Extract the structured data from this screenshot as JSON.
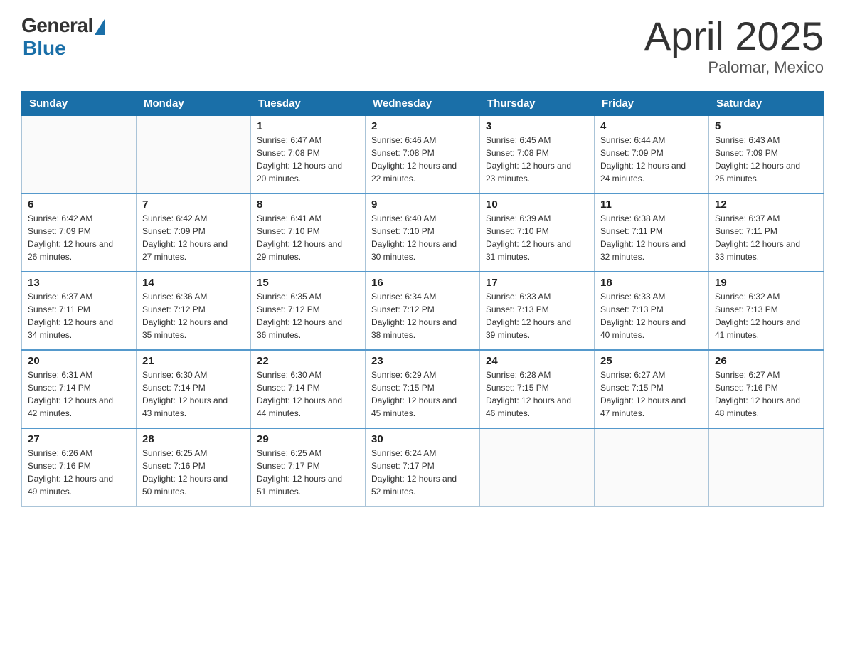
{
  "logo": {
    "general": "General",
    "blue": "Blue"
  },
  "title": "April 2025",
  "subtitle": "Palomar, Mexico",
  "days_header": [
    "Sunday",
    "Monday",
    "Tuesday",
    "Wednesday",
    "Thursday",
    "Friday",
    "Saturday"
  ],
  "weeks": [
    [
      {
        "day": "",
        "sunrise": "",
        "sunset": "",
        "daylight": ""
      },
      {
        "day": "",
        "sunrise": "",
        "sunset": "",
        "daylight": ""
      },
      {
        "day": "1",
        "sunrise": "Sunrise: 6:47 AM",
        "sunset": "Sunset: 7:08 PM",
        "daylight": "Daylight: 12 hours and 20 minutes."
      },
      {
        "day": "2",
        "sunrise": "Sunrise: 6:46 AM",
        "sunset": "Sunset: 7:08 PM",
        "daylight": "Daylight: 12 hours and 22 minutes."
      },
      {
        "day": "3",
        "sunrise": "Sunrise: 6:45 AM",
        "sunset": "Sunset: 7:08 PM",
        "daylight": "Daylight: 12 hours and 23 minutes."
      },
      {
        "day": "4",
        "sunrise": "Sunrise: 6:44 AM",
        "sunset": "Sunset: 7:09 PM",
        "daylight": "Daylight: 12 hours and 24 minutes."
      },
      {
        "day": "5",
        "sunrise": "Sunrise: 6:43 AM",
        "sunset": "Sunset: 7:09 PM",
        "daylight": "Daylight: 12 hours and 25 minutes."
      }
    ],
    [
      {
        "day": "6",
        "sunrise": "Sunrise: 6:42 AM",
        "sunset": "Sunset: 7:09 PM",
        "daylight": "Daylight: 12 hours and 26 minutes."
      },
      {
        "day": "7",
        "sunrise": "Sunrise: 6:42 AM",
        "sunset": "Sunset: 7:09 PM",
        "daylight": "Daylight: 12 hours and 27 minutes."
      },
      {
        "day": "8",
        "sunrise": "Sunrise: 6:41 AM",
        "sunset": "Sunset: 7:10 PM",
        "daylight": "Daylight: 12 hours and 29 minutes."
      },
      {
        "day": "9",
        "sunrise": "Sunrise: 6:40 AM",
        "sunset": "Sunset: 7:10 PM",
        "daylight": "Daylight: 12 hours and 30 minutes."
      },
      {
        "day": "10",
        "sunrise": "Sunrise: 6:39 AM",
        "sunset": "Sunset: 7:10 PM",
        "daylight": "Daylight: 12 hours and 31 minutes."
      },
      {
        "day": "11",
        "sunrise": "Sunrise: 6:38 AM",
        "sunset": "Sunset: 7:11 PM",
        "daylight": "Daylight: 12 hours and 32 minutes."
      },
      {
        "day": "12",
        "sunrise": "Sunrise: 6:37 AM",
        "sunset": "Sunset: 7:11 PM",
        "daylight": "Daylight: 12 hours and 33 minutes."
      }
    ],
    [
      {
        "day": "13",
        "sunrise": "Sunrise: 6:37 AM",
        "sunset": "Sunset: 7:11 PM",
        "daylight": "Daylight: 12 hours and 34 minutes."
      },
      {
        "day": "14",
        "sunrise": "Sunrise: 6:36 AM",
        "sunset": "Sunset: 7:12 PM",
        "daylight": "Daylight: 12 hours and 35 minutes."
      },
      {
        "day": "15",
        "sunrise": "Sunrise: 6:35 AM",
        "sunset": "Sunset: 7:12 PM",
        "daylight": "Daylight: 12 hours and 36 minutes."
      },
      {
        "day": "16",
        "sunrise": "Sunrise: 6:34 AM",
        "sunset": "Sunset: 7:12 PM",
        "daylight": "Daylight: 12 hours and 38 minutes."
      },
      {
        "day": "17",
        "sunrise": "Sunrise: 6:33 AM",
        "sunset": "Sunset: 7:13 PM",
        "daylight": "Daylight: 12 hours and 39 minutes."
      },
      {
        "day": "18",
        "sunrise": "Sunrise: 6:33 AM",
        "sunset": "Sunset: 7:13 PM",
        "daylight": "Daylight: 12 hours and 40 minutes."
      },
      {
        "day": "19",
        "sunrise": "Sunrise: 6:32 AM",
        "sunset": "Sunset: 7:13 PM",
        "daylight": "Daylight: 12 hours and 41 minutes."
      }
    ],
    [
      {
        "day": "20",
        "sunrise": "Sunrise: 6:31 AM",
        "sunset": "Sunset: 7:14 PM",
        "daylight": "Daylight: 12 hours and 42 minutes."
      },
      {
        "day": "21",
        "sunrise": "Sunrise: 6:30 AM",
        "sunset": "Sunset: 7:14 PM",
        "daylight": "Daylight: 12 hours and 43 minutes."
      },
      {
        "day": "22",
        "sunrise": "Sunrise: 6:30 AM",
        "sunset": "Sunset: 7:14 PM",
        "daylight": "Daylight: 12 hours and 44 minutes."
      },
      {
        "day": "23",
        "sunrise": "Sunrise: 6:29 AM",
        "sunset": "Sunset: 7:15 PM",
        "daylight": "Daylight: 12 hours and 45 minutes."
      },
      {
        "day": "24",
        "sunrise": "Sunrise: 6:28 AM",
        "sunset": "Sunset: 7:15 PM",
        "daylight": "Daylight: 12 hours and 46 minutes."
      },
      {
        "day": "25",
        "sunrise": "Sunrise: 6:27 AM",
        "sunset": "Sunset: 7:15 PM",
        "daylight": "Daylight: 12 hours and 47 minutes."
      },
      {
        "day": "26",
        "sunrise": "Sunrise: 6:27 AM",
        "sunset": "Sunset: 7:16 PM",
        "daylight": "Daylight: 12 hours and 48 minutes."
      }
    ],
    [
      {
        "day": "27",
        "sunrise": "Sunrise: 6:26 AM",
        "sunset": "Sunset: 7:16 PM",
        "daylight": "Daylight: 12 hours and 49 minutes."
      },
      {
        "day": "28",
        "sunrise": "Sunrise: 6:25 AM",
        "sunset": "Sunset: 7:16 PM",
        "daylight": "Daylight: 12 hours and 50 minutes."
      },
      {
        "day": "29",
        "sunrise": "Sunrise: 6:25 AM",
        "sunset": "Sunset: 7:17 PM",
        "daylight": "Daylight: 12 hours and 51 minutes."
      },
      {
        "day": "30",
        "sunrise": "Sunrise: 6:24 AM",
        "sunset": "Sunset: 7:17 PM",
        "daylight": "Daylight: 12 hours and 52 minutes."
      },
      {
        "day": "",
        "sunrise": "",
        "sunset": "",
        "daylight": ""
      },
      {
        "day": "",
        "sunrise": "",
        "sunset": "",
        "daylight": ""
      },
      {
        "day": "",
        "sunrise": "",
        "sunset": "",
        "daylight": ""
      }
    ]
  ]
}
